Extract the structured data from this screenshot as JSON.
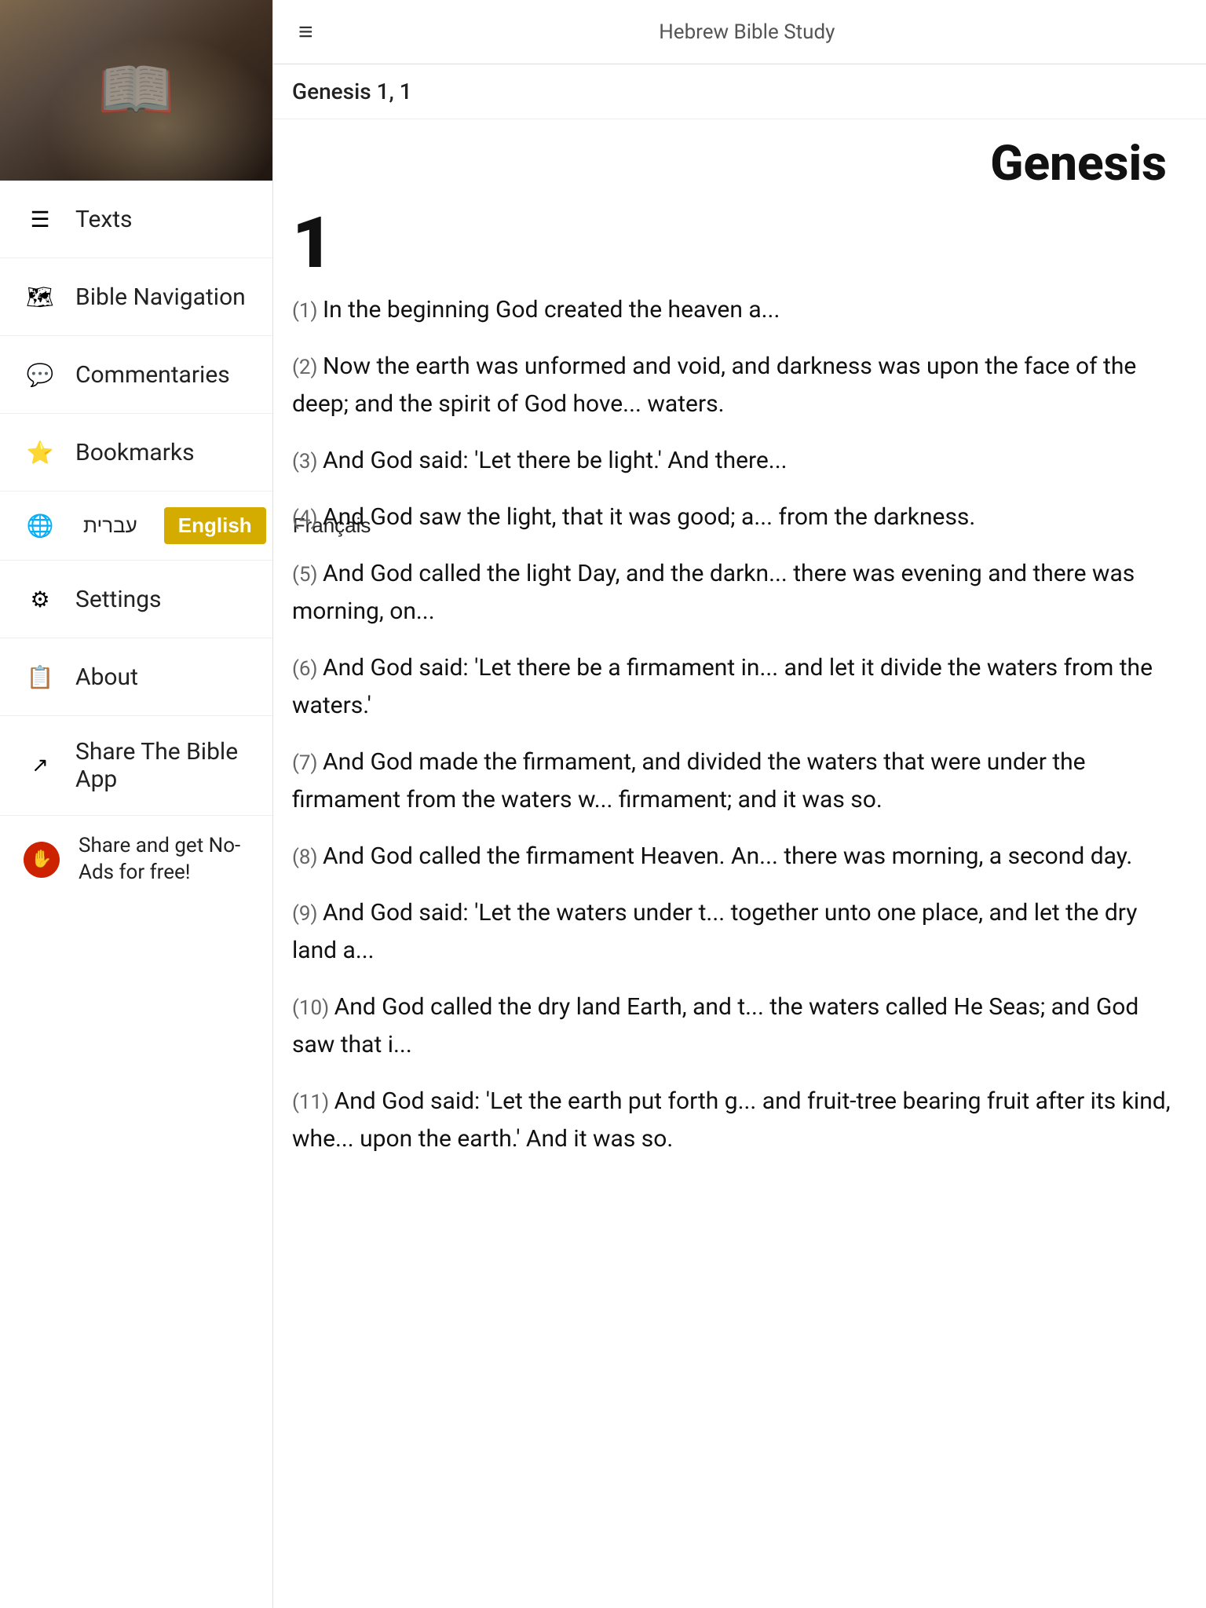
{
  "app": {
    "title": "Hebrew Bible Study"
  },
  "sidebar": {
    "nav_items": [
      {
        "id": "texts",
        "label": "Texts",
        "icon": "☰"
      },
      {
        "id": "bible-navigation",
        "label": "Bible Navigation",
        "icon": "🗺"
      },
      {
        "id": "commentaries",
        "label": "Commentaries",
        "icon": "💬"
      },
      {
        "id": "bookmarks",
        "label": "Bookmarks",
        "icon": "⭐"
      }
    ],
    "languages": {
      "label_globe": "🌐",
      "options": [
        "עברית",
        "English",
        "Français"
      ],
      "active": "English"
    },
    "settings": {
      "label": "Settings",
      "icon": "⚙"
    },
    "about": {
      "label": "About",
      "icon": "📋"
    },
    "share": {
      "label": "Share The Bible App",
      "icon": "↗"
    },
    "share_noad": {
      "label": "Share and get No-Ads for free!",
      "icon": "✋"
    }
  },
  "header": {
    "hamburger": "≡",
    "title": "Hebrew Bible Study",
    "breadcrumb": "Genesis 1, 1"
  },
  "content": {
    "book_title": "Genesis",
    "chapter_num": "1",
    "verses": [
      {
        "num": "(1)",
        "text": "In the beginning God created the heaven a..."
      },
      {
        "num": "(2)",
        "text": "Now the earth was unformed and void, and darkness was upon the face of the deep; and the spirit of God hove... waters."
      },
      {
        "num": "(3)",
        "text": "And God said: 'Let there be light.' And there..."
      },
      {
        "num": "(4)",
        "text": "And God saw the light, that it was good; a... from the darkness."
      },
      {
        "num": "(5)",
        "text": "And God called the light Day, and the darkn... there was evening and there was morning, on..."
      },
      {
        "num": "(6)",
        "text": "And God said: 'Let there be a firmament in... and let it divide the waters from the waters.'"
      },
      {
        "num": "(7)",
        "text": "And God made the firmament, and divided the waters that were under the firmament from the waters w... firmament; and it was so."
      },
      {
        "num": "(8)",
        "text": "And God called the firmament Heaven. An... there was morning, a second day."
      },
      {
        "num": "(9)",
        "text": "And God said: 'Let the waters under t... together unto one place, and let the dry land a..."
      },
      {
        "num": "(10)",
        "text": "And God called the dry land Earth, and t... the waters called He Seas; and God saw that i..."
      },
      {
        "num": "(11)",
        "text": "And God said: 'Let the earth put forth g... and fruit-tree bearing fruit after its kind, whe... upon the earth.' And it was so."
      }
    ]
  }
}
